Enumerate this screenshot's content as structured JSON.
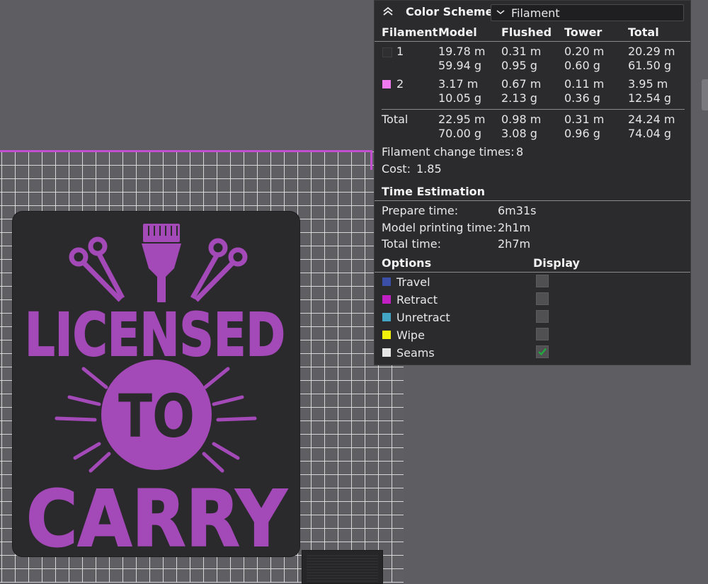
{
  "legend": {
    "title": "Color Scheme",
    "scheme_select": "Filament",
    "columns": [
      "Filament",
      "Model",
      "Flushed",
      "Tower",
      "Total"
    ],
    "filaments": [
      {
        "id": "1",
        "color": "#2f2f31",
        "model_m": "19.78 m",
        "model_g": "59.94 g",
        "flushed_m": "0.31 m",
        "flushed_g": "0.95 g",
        "tower_m": "0.20 m",
        "tower_g": "0.60 g",
        "total_m": "20.29 m",
        "total_g": "61.50 g"
      },
      {
        "id": "2",
        "color": "#f07bf0",
        "model_m": "3.17 m",
        "model_g": "10.05 g",
        "flushed_m": "0.67 m",
        "flushed_g": "2.13 g",
        "tower_m": "0.11 m",
        "tower_g": "0.36 g",
        "total_m": "3.95 m",
        "total_g": "12.54 g"
      }
    ],
    "total": {
      "label": "Total",
      "model_m": "22.95 m",
      "model_g": "70.00 g",
      "flushed_m": "0.98 m",
      "flushed_g": "3.08 g",
      "tower_m": "0.31 m",
      "tower_g": "0.96 g",
      "total_m": "24.24 m",
      "total_g": "74.04 g"
    },
    "change_times_label": "Filament change times:",
    "change_times_value": "8",
    "cost_label": "Cost:",
    "cost_value": "1.85",
    "time_title": "Time Estimation",
    "time": [
      {
        "label": "Prepare time:",
        "value": "6m31s"
      },
      {
        "label": "Model printing time:",
        "value": "2h1m"
      },
      {
        "label": "Total time:",
        "value": "2h7m"
      }
    ],
    "options_header": "Options",
    "display_header": "Display",
    "options": [
      {
        "label": "Travel",
        "color": "#3b4ea8",
        "checked": false
      },
      {
        "label": "Retract",
        "color": "#c21fc4",
        "checked": false
      },
      {
        "label": "Unretract",
        "color": "#43a6c6",
        "checked": false
      },
      {
        "label": "Wipe",
        "color": "#f2f20a",
        "checked": false
      },
      {
        "label": "Seams",
        "color": "#e6e6e6",
        "checked": true
      }
    ]
  },
  "model": {
    "line1": "LICENSED",
    "line2": "TO",
    "line3": "CARRY",
    "print_color": "#a349b8",
    "plate_color": "#2a292c"
  }
}
